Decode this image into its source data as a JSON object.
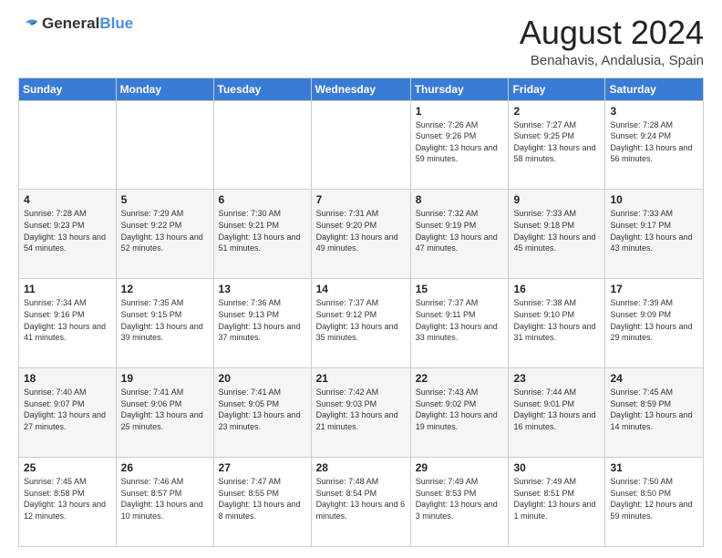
{
  "header": {
    "logo_general": "General",
    "logo_blue": "Blue",
    "month_year": "August 2024",
    "location": "Benahavis, Andalusia, Spain"
  },
  "days_of_week": [
    "Sunday",
    "Monday",
    "Tuesday",
    "Wednesday",
    "Thursday",
    "Friday",
    "Saturday"
  ],
  "weeks": [
    [
      {
        "day": "",
        "sunrise": "",
        "sunset": "",
        "daylight": ""
      },
      {
        "day": "",
        "sunrise": "",
        "sunset": "",
        "daylight": ""
      },
      {
        "day": "",
        "sunrise": "",
        "sunset": "",
        "daylight": ""
      },
      {
        "day": "",
        "sunrise": "",
        "sunset": "",
        "daylight": ""
      },
      {
        "day": "1",
        "sunrise": "Sunrise: 7:26 AM",
        "sunset": "Sunset: 9:26 PM",
        "daylight": "Daylight: 13 hours and 59 minutes."
      },
      {
        "day": "2",
        "sunrise": "Sunrise: 7:27 AM",
        "sunset": "Sunset: 9:25 PM",
        "daylight": "Daylight: 13 hours and 58 minutes."
      },
      {
        "day": "3",
        "sunrise": "Sunrise: 7:28 AM",
        "sunset": "Sunset: 9:24 PM",
        "daylight": "Daylight: 13 hours and 56 minutes."
      }
    ],
    [
      {
        "day": "4",
        "sunrise": "Sunrise: 7:28 AM",
        "sunset": "Sunset: 9:23 PM",
        "daylight": "Daylight: 13 hours and 54 minutes."
      },
      {
        "day": "5",
        "sunrise": "Sunrise: 7:29 AM",
        "sunset": "Sunset: 9:22 PM",
        "daylight": "Daylight: 13 hours and 52 minutes."
      },
      {
        "day": "6",
        "sunrise": "Sunrise: 7:30 AM",
        "sunset": "Sunset: 9:21 PM",
        "daylight": "Daylight: 13 hours and 51 minutes."
      },
      {
        "day": "7",
        "sunrise": "Sunrise: 7:31 AM",
        "sunset": "Sunset: 9:20 PM",
        "daylight": "Daylight: 13 hours and 49 minutes."
      },
      {
        "day": "8",
        "sunrise": "Sunrise: 7:32 AM",
        "sunset": "Sunset: 9:19 PM",
        "daylight": "Daylight: 13 hours and 47 minutes."
      },
      {
        "day": "9",
        "sunrise": "Sunrise: 7:33 AM",
        "sunset": "Sunset: 9:18 PM",
        "daylight": "Daylight: 13 hours and 45 minutes."
      },
      {
        "day": "10",
        "sunrise": "Sunrise: 7:33 AM",
        "sunset": "Sunset: 9:17 PM",
        "daylight": "Daylight: 13 hours and 43 minutes."
      }
    ],
    [
      {
        "day": "11",
        "sunrise": "Sunrise: 7:34 AM",
        "sunset": "Sunset: 9:16 PM",
        "daylight": "Daylight: 13 hours and 41 minutes."
      },
      {
        "day": "12",
        "sunrise": "Sunrise: 7:35 AM",
        "sunset": "Sunset: 9:15 PM",
        "daylight": "Daylight: 13 hours and 39 minutes."
      },
      {
        "day": "13",
        "sunrise": "Sunrise: 7:36 AM",
        "sunset": "Sunset: 9:13 PM",
        "daylight": "Daylight: 13 hours and 37 minutes."
      },
      {
        "day": "14",
        "sunrise": "Sunrise: 7:37 AM",
        "sunset": "Sunset: 9:12 PM",
        "daylight": "Daylight: 13 hours and 35 minutes."
      },
      {
        "day": "15",
        "sunrise": "Sunrise: 7:37 AM",
        "sunset": "Sunset: 9:11 PM",
        "daylight": "Daylight: 13 hours and 33 minutes."
      },
      {
        "day": "16",
        "sunrise": "Sunrise: 7:38 AM",
        "sunset": "Sunset: 9:10 PM",
        "daylight": "Daylight: 13 hours and 31 minutes."
      },
      {
        "day": "17",
        "sunrise": "Sunrise: 7:39 AM",
        "sunset": "Sunset: 9:09 PM",
        "daylight": "Daylight: 13 hours and 29 minutes."
      }
    ],
    [
      {
        "day": "18",
        "sunrise": "Sunrise: 7:40 AM",
        "sunset": "Sunset: 9:07 PM",
        "daylight": "Daylight: 13 hours and 27 minutes."
      },
      {
        "day": "19",
        "sunrise": "Sunrise: 7:41 AM",
        "sunset": "Sunset: 9:06 PM",
        "daylight": "Daylight: 13 hours and 25 minutes."
      },
      {
        "day": "20",
        "sunrise": "Sunrise: 7:41 AM",
        "sunset": "Sunset: 9:05 PM",
        "daylight": "Daylight: 13 hours and 23 minutes."
      },
      {
        "day": "21",
        "sunrise": "Sunrise: 7:42 AM",
        "sunset": "Sunset: 9:03 PM",
        "daylight": "Daylight: 13 hours and 21 minutes."
      },
      {
        "day": "22",
        "sunrise": "Sunrise: 7:43 AM",
        "sunset": "Sunset: 9:02 PM",
        "daylight": "Daylight: 13 hours and 19 minutes."
      },
      {
        "day": "23",
        "sunrise": "Sunrise: 7:44 AM",
        "sunset": "Sunset: 9:01 PM",
        "daylight": "Daylight: 13 hours and 16 minutes."
      },
      {
        "day": "24",
        "sunrise": "Sunrise: 7:45 AM",
        "sunset": "Sunset: 8:59 PM",
        "daylight": "Daylight: 13 hours and 14 minutes."
      }
    ],
    [
      {
        "day": "25",
        "sunrise": "Sunrise: 7:45 AM",
        "sunset": "Sunset: 8:58 PM",
        "daylight": "Daylight: 13 hours and 12 minutes."
      },
      {
        "day": "26",
        "sunrise": "Sunrise: 7:46 AM",
        "sunset": "Sunset: 8:57 PM",
        "daylight": "Daylight: 13 hours and 10 minutes."
      },
      {
        "day": "27",
        "sunrise": "Sunrise: 7:47 AM",
        "sunset": "Sunset: 8:55 PM",
        "daylight": "Daylight: 13 hours and 8 minutes."
      },
      {
        "day": "28",
        "sunrise": "Sunrise: 7:48 AM",
        "sunset": "Sunset: 8:54 PM",
        "daylight": "Daylight: 13 hours and 6 minutes."
      },
      {
        "day": "29",
        "sunrise": "Sunrise: 7:49 AM",
        "sunset": "Sunset: 8:53 PM",
        "daylight": "Daylight: 13 hours and 3 minutes."
      },
      {
        "day": "30",
        "sunrise": "Sunrise: 7:49 AM",
        "sunset": "Sunset: 8:51 PM",
        "daylight": "Daylight: 13 hours and 1 minute."
      },
      {
        "day": "31",
        "sunrise": "Sunrise: 7:50 AM",
        "sunset": "Sunset: 8:50 PM",
        "daylight": "Daylight: 12 hours and 59 minutes."
      }
    ]
  ]
}
